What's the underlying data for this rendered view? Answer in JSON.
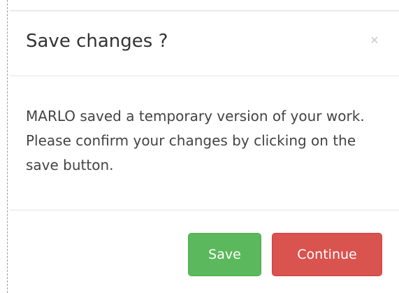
{
  "dialog": {
    "title": "Save changes ?",
    "close_label": "×",
    "message": "MARLO saved a temporary version of your work. Please confirm your changes by clicking on the save button.",
    "buttons": {
      "save_label": "Save",
      "continue_label": "Continue"
    },
    "colors": {
      "save": "#5cb85c",
      "continue": "#d9534f"
    }
  }
}
